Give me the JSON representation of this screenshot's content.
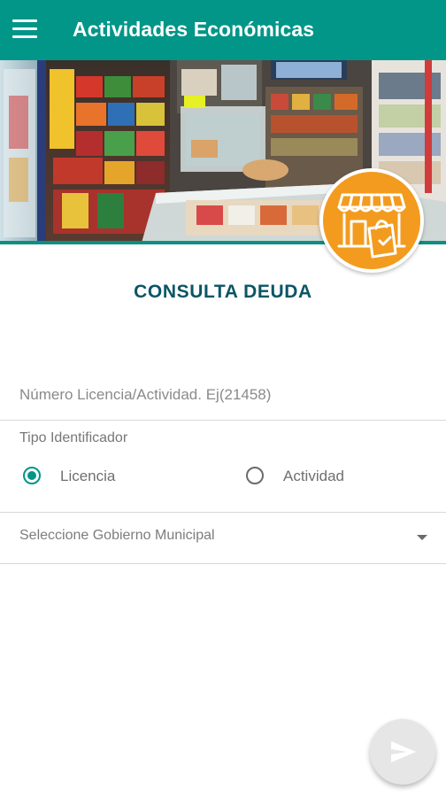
{
  "app_bar": {
    "title": "Actividades Económicas",
    "menu_icon": "hamburger-menu-icon"
  },
  "banner": {
    "description_icon": "storefront-icon",
    "badge_color": "#f39b1e"
  },
  "page": {
    "heading": "CONSULTA DEUDA"
  },
  "form": {
    "license_field": {
      "placeholder": "Número Licencia/Actividad. Ej(21458)",
      "value": ""
    },
    "id_type": {
      "label": "Tipo Identificador",
      "options": [
        {
          "label": "Licencia",
          "selected": true
        },
        {
          "label": "Actividad",
          "selected": false
        }
      ]
    },
    "municipality_select": {
      "placeholder": "Seleccione Gobierno Municipal",
      "icon": "dropdown-arrow-icon"
    }
  },
  "fab": {
    "icon": "send-icon"
  },
  "colors": {
    "primary": "#019688",
    "heading": "#0b5565",
    "accent": "#f39b1e"
  }
}
